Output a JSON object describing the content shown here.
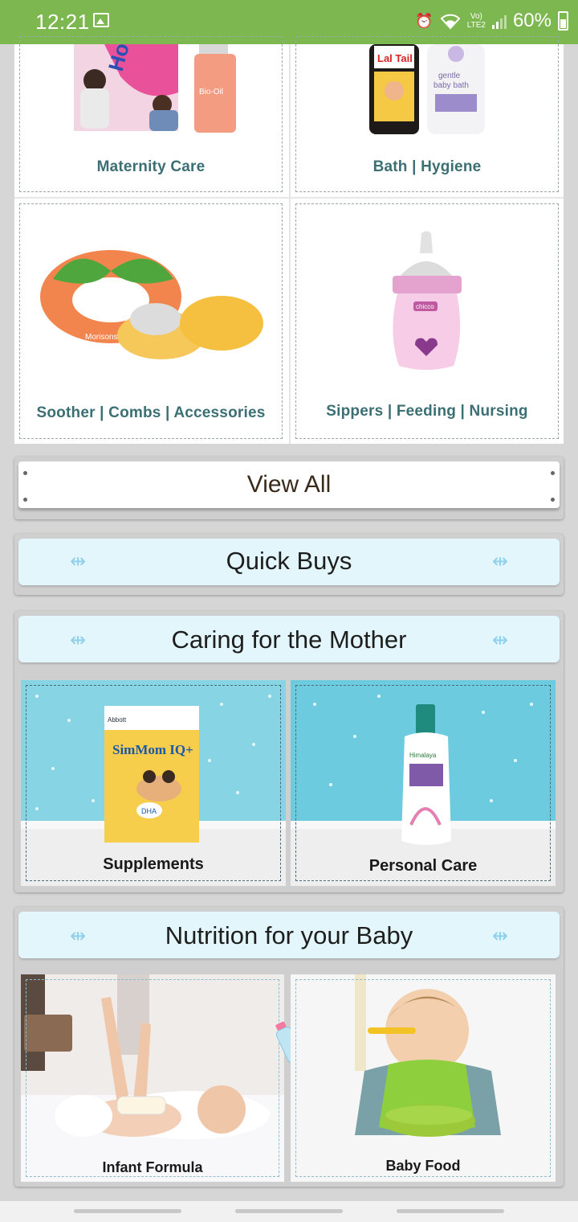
{
  "status_bar": {
    "time": "12:21",
    "network_top": "Vo)",
    "network_bottom": "LTE2",
    "battery": "60%"
  },
  "categories": [
    {
      "label": "Maternity Care"
    },
    {
      "label": "Bath | Hygiene"
    },
    {
      "label": "Soother | Combs | Accessories"
    },
    {
      "label": "Sippers | Feeding | Nursing"
    }
  ],
  "view_all": {
    "label": "View All"
  },
  "quick_buys": {
    "title": "Quick Buys"
  },
  "mother_section": {
    "title": "Caring for the Mother",
    "tiles": [
      {
        "label": "Supplements"
      },
      {
        "label": "Personal Care"
      }
    ]
  },
  "baby_section": {
    "title": "Nutrition for your Baby",
    "tiles": [
      {
        "label": "Infant Formula"
      },
      {
        "label": "Baby Food"
      }
    ]
  },
  "products": {
    "lal_tail": "Lal Tail",
    "gentle_bath": "gentle baby bath",
    "morisons": "Morisons",
    "chicco": "chicco",
    "abbott": "Abbott",
    "simmom": "SimMom IQ+",
    "dha": "DHA",
    "himalaya": "Himalaya",
    "horlicks": "Horlicks",
    "bio_oil": "Bio-Oil"
  },
  "colors": {
    "status_bar": "#7cb74f",
    "category_label": "#3b6f73",
    "strip_bg": "#e2f6fb",
    "sky_bg": "#7fd3e3"
  }
}
